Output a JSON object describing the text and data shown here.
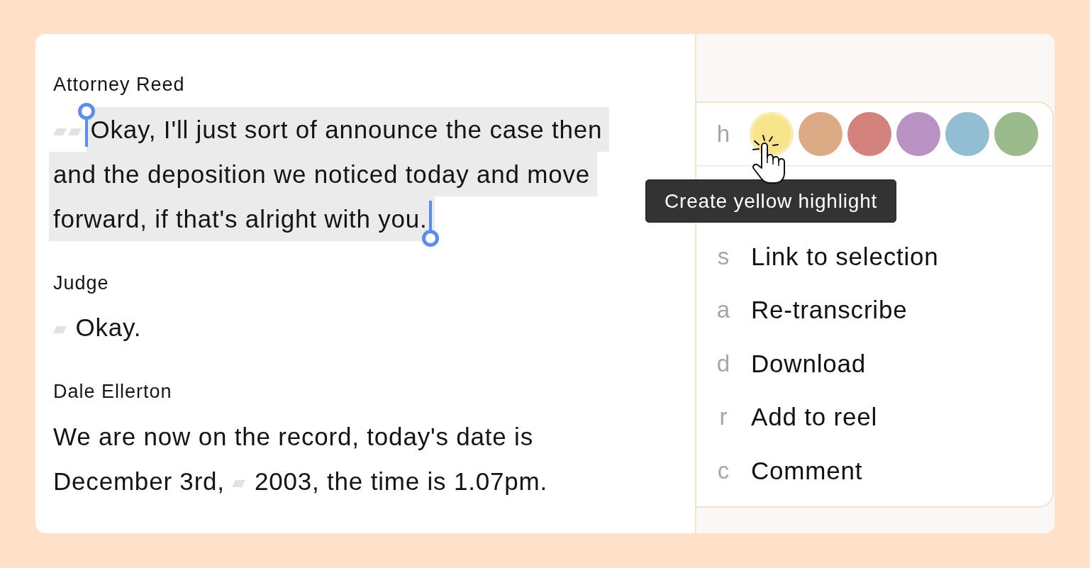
{
  "transcript": [
    {
      "speaker": "Attorney Reed",
      "segments": [
        {
          "kind": "pause",
          "selected": false
        },
        {
          "kind": "pause",
          "selected": false
        },
        {
          "kind": "text",
          "text": "Okay, I'll just sort of announce the case then",
          "selected": true
        },
        {
          "kind": "text",
          "text": "and the deposition we noticed today and move",
          "selected": true
        },
        {
          "kind": "text",
          "text": "forward, if that's alright with you.",
          "selected": true
        }
      ]
    },
    {
      "speaker": "Judge",
      "segments": [
        {
          "kind": "pause",
          "selected": false
        },
        {
          "kind": "text",
          "text": "Okay.",
          "selected": false
        }
      ]
    },
    {
      "speaker": "Dale Ellerton",
      "segments": [
        {
          "kind": "text",
          "text": "We are now on the record, today's date is",
          "selected": false
        },
        {
          "kind": "text",
          "text": "December 3rd,",
          "selected": false
        },
        {
          "kind": "pause",
          "selected": false
        },
        {
          "kind": "text",
          "text": "2003, the time is 1.07pm.",
          "selected": false
        }
      ]
    }
  ],
  "highlight_menu": {
    "shortcut": "h",
    "colors": [
      {
        "color": "#f8e48b",
        "hovered": true
      },
      {
        "color": "#dcab86",
        "hovered": false
      },
      {
        "color": "#d3827e",
        "hovered": false
      },
      {
        "color": "#b893c3",
        "hovered": false
      },
      {
        "color": "#93bdd3",
        "hovered": false
      },
      {
        "color": "#9bbb8d",
        "hovered": false
      }
    ],
    "tooltip": "Create yellow highlight",
    "items": [
      {
        "shortcut": "s",
        "label": "Link to selection"
      },
      {
        "shortcut": "a",
        "label": "Re-transcribe"
      },
      {
        "shortcut": "d",
        "label": "Download"
      },
      {
        "shortcut": "r",
        "label": "Add to reel"
      },
      {
        "shortcut": "c",
        "label": "Comment"
      }
    ]
  }
}
